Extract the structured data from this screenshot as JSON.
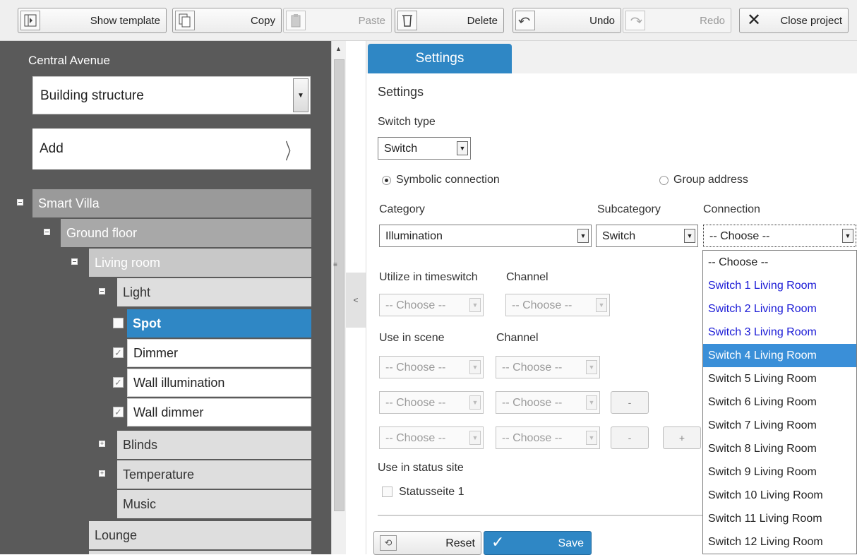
{
  "toolbar": {
    "show_template": "Show template",
    "copy": "Copy",
    "paste": "Paste",
    "delete": "Delete",
    "undo": "Undo",
    "redo": "Redo",
    "close_project": "Close project"
  },
  "left": {
    "project_title": "Central Avenue",
    "view_select": "Building structure",
    "add_label": "Add",
    "tree": {
      "smart_villa": "Smart Villa",
      "ground_floor": "Ground floor",
      "living_room": "Living room",
      "light": "Light",
      "spot": "Spot",
      "dimmer": "Dimmer",
      "wall_illumination": "Wall illumination",
      "wall_dimmer": "Wall dimmer",
      "blinds": "Blinds",
      "temperature": "Temperature",
      "music": "Music",
      "lounge": "Lounge"
    }
  },
  "right": {
    "tab": "Settings",
    "heading": "Settings",
    "switch_type_label": "Switch type",
    "switch_type_value": "Switch",
    "radio_symbolic": "Symbolic connection",
    "radio_group": "Group address",
    "category_label": "Category",
    "subcategory_label": "Subcategory",
    "connection_label": "Connection",
    "category_value": "Illumination",
    "subcategory_value": "Switch",
    "connection_value": "-- Choose --",
    "timeswitch_label": "Utilize in timeswitch",
    "channel_label": "Channel",
    "scene_label": "Use in scene",
    "choose": "-- Choose --",
    "minus": "-",
    "plus": "+",
    "status_site_label": "Use in status site",
    "status_site_item": "Statusseite 1",
    "reset": "Reset",
    "save": "Save"
  },
  "dropdown": {
    "items": [
      "-- Choose --",
      "Switch 1 Living Room",
      "Switch 2 Living Room",
      "Switch 3 Living Room",
      "Switch 4 Living Room",
      "Switch 5 Living Room",
      "Switch 6 Living Room",
      "Switch 7 Living Room",
      "Switch 8 Living Room",
      "Switch 9 Living Room",
      "Switch 10 Living Room",
      "Switch 11 Living Room",
      "Switch 12 Living Room"
    ],
    "highlighted": "Switch 4 Living Room"
  },
  "colors": {
    "accent": "#2f87c5",
    "panel_dark": "#5a5a5a",
    "link_blue": "#1a1ad6",
    "highlight": "#3a8fd8"
  },
  "icons": {
    "show_template": "panel-toggle-icon",
    "copy": "copy-icon",
    "paste": "paste-icon",
    "delete": "trash-icon",
    "undo": "undo-icon",
    "redo": "redo-icon",
    "close_project": "close-icon"
  }
}
